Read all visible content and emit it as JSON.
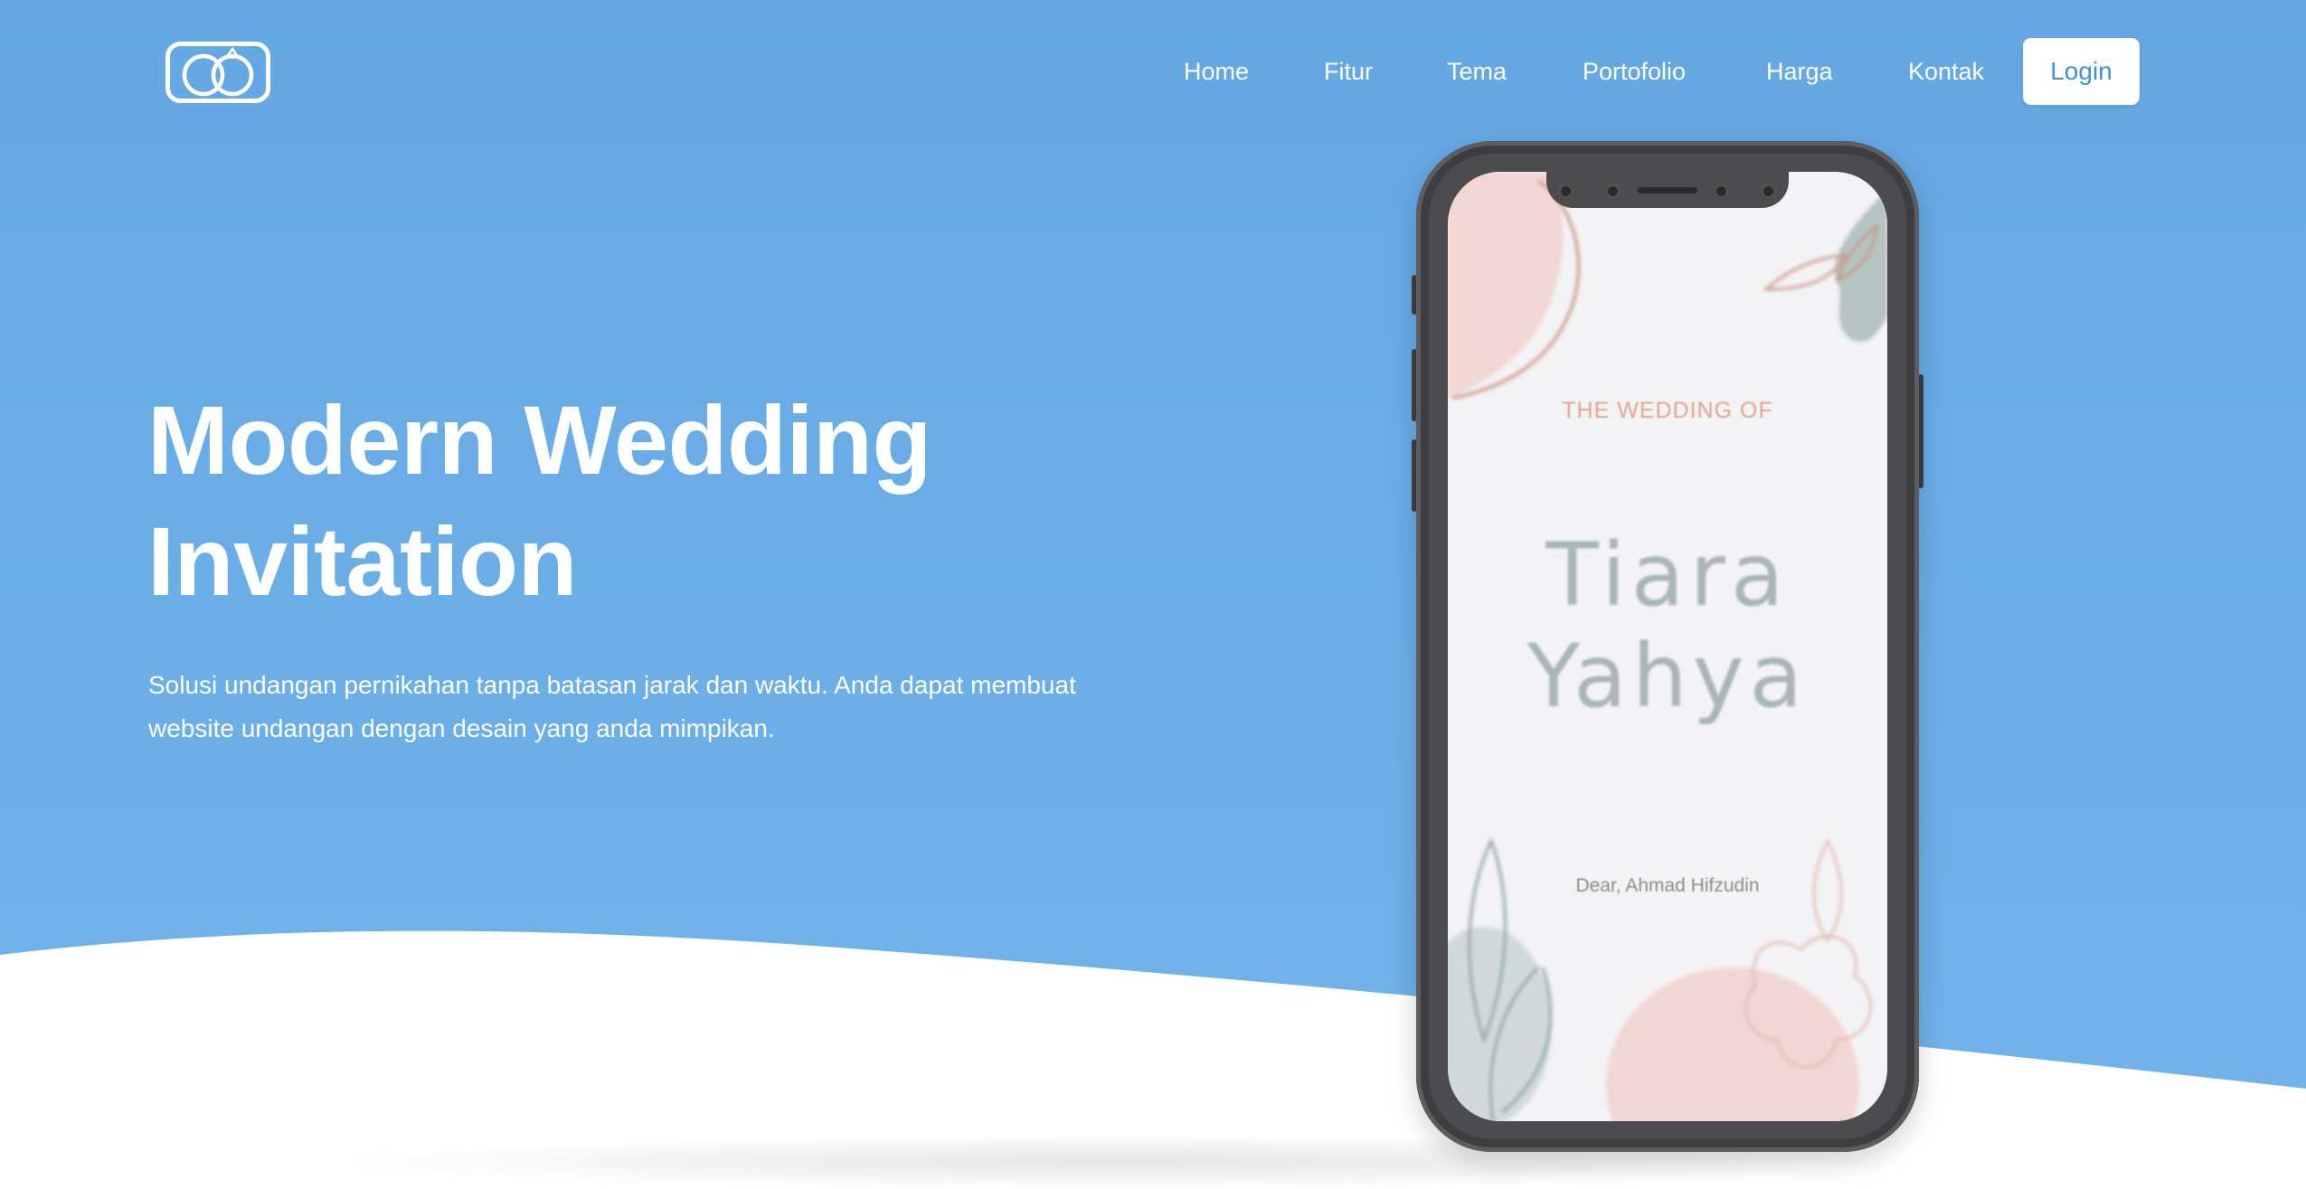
{
  "nav": {
    "brand_icon": "rings-logo-icon",
    "links": [
      "Home",
      "Fitur",
      "Tema",
      "Portofolio",
      "Harga",
      "Kontak"
    ],
    "login_label": "Login"
  },
  "hero": {
    "title_line1": "Modern Wedding",
    "title_line2": "Invitation",
    "subtitle_line1": "Solusi undangan pernikahan tanpa batasan jarak dan waktu. Anda dapat membuat",
    "subtitle_line2": "website undangan dengan desain yang anda mimpikan."
  },
  "invitation_preview": {
    "eyebrow": "THE WEDDING OF",
    "name1": "Tiara",
    "name2": "Yahya",
    "dear": "Dear, Ahmad Hifzudin"
  },
  "colors": {
    "hero_blue": "#64a7e4",
    "login_text": "#3f8fd8",
    "phone_body": "#4c4c4e",
    "blush": "#f1d6d3",
    "sage": "#a9bbb6"
  }
}
